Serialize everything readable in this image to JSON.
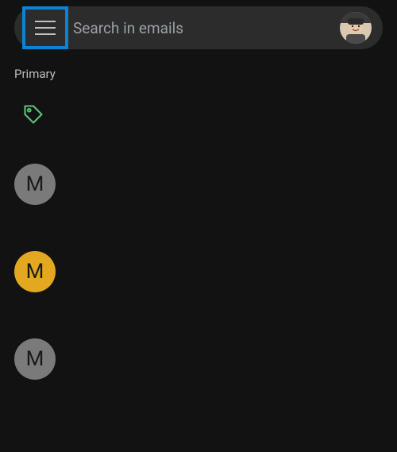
{
  "search": {
    "placeholder": "Search in emails"
  },
  "section": {
    "label": "Primary"
  },
  "items": [
    {
      "initial": "M",
      "color": "grey"
    },
    {
      "initial": "M",
      "color": "yellow"
    },
    {
      "initial": "M",
      "color": "grey"
    }
  ]
}
